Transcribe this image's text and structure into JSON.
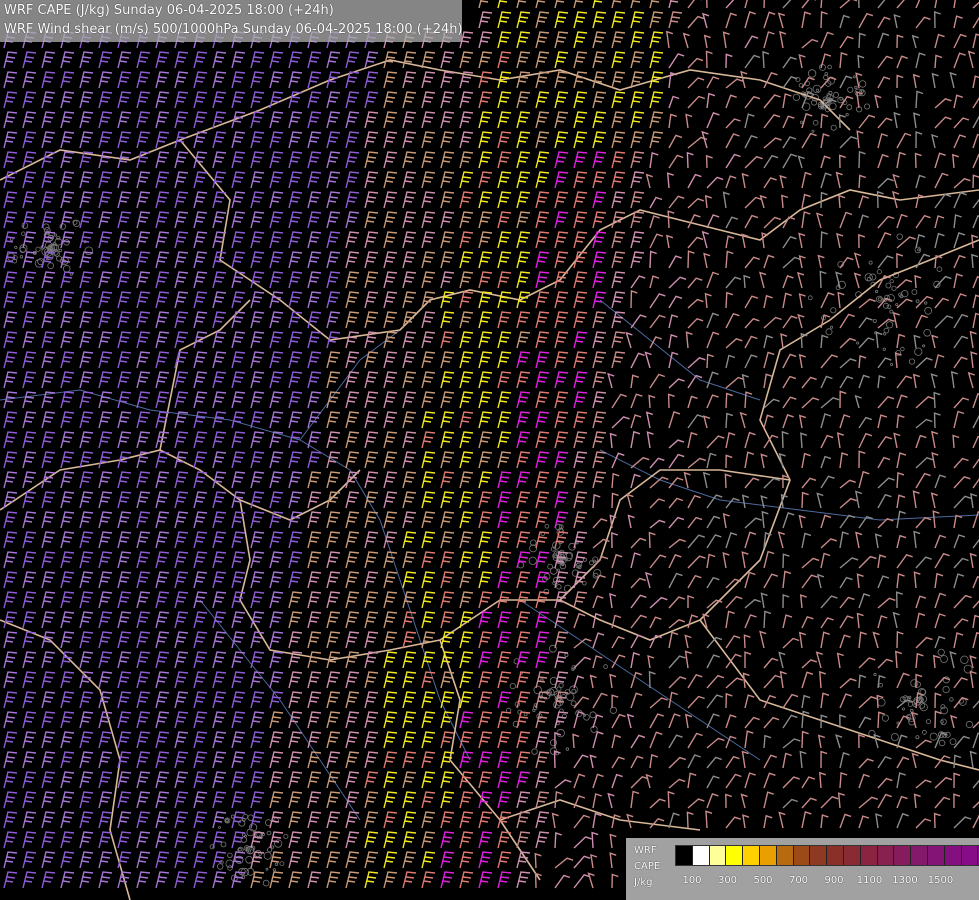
{
  "header": {
    "title_line1": "WRF CAPE (J/kg) Sunday 06-04-2025 18:00 (+24h)",
    "title_line2": "WRF Wind shear (m/s) 500/1000hPa Sunday 06-04-2025 18:00 (+24h)"
  },
  "legend": {
    "label_line1": "WRF",
    "label_line2": "CAPE",
    "label_line3": "J/kg",
    "colors": [
      "#000000",
      "#ffffff",
      "#ffff99",
      "#ffff00",
      "#ffd000",
      "#e8a000",
      "#b86a10",
      "#9c4a18",
      "#8e3a22",
      "#8a3028",
      "#8a2a32",
      "#8a2440",
      "#882050",
      "#861c5e",
      "#84186a",
      "#841476",
      "#841080",
      "#860c88",
      "#880890",
      "#8a0898"
    ],
    "ticks": [
      "100",
      "300",
      "500",
      "700",
      "900",
      "1100",
      "1300",
      "1500"
    ]
  },
  "map": {
    "barb_palette": {
      "purple": "#8e5cd6",
      "violet": "#a675d6",
      "pink": "#cf8fb0",
      "salmon": "#e07a72",
      "tan": "#c89a78",
      "yellow": "#f2ea1e",
      "magenta": "#e020e0",
      "rose": "#c88a8a",
      "gray": "#8c8c8c"
    },
    "border_color": "#d8b898",
    "river_color": "#4d6aa0"
  }
}
